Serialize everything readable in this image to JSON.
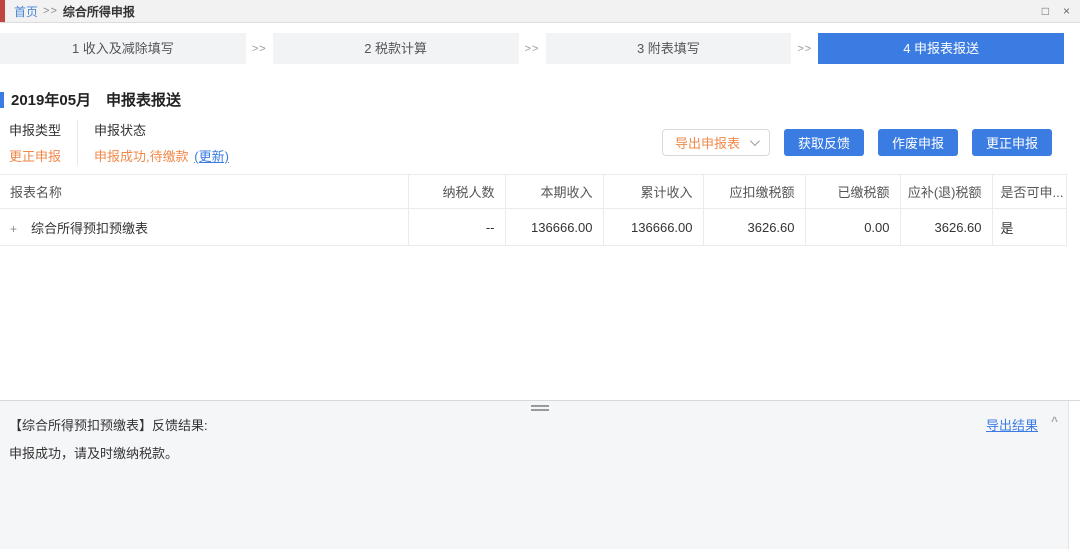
{
  "breadcrumb": {
    "home": "首页",
    "separator": ">>",
    "current": "综合所得申报"
  },
  "window_controls": {
    "maximize": "□",
    "close": "×"
  },
  "steps": {
    "separator": ">>",
    "items": [
      {
        "label": "1 收入及减除填写"
      },
      {
        "label": "2 税款计算"
      },
      {
        "label": "3 附表填写"
      },
      {
        "label": "4 申报表报送",
        "active": true
      }
    ]
  },
  "page": {
    "title": "2019年05月　申报表报送"
  },
  "meta": {
    "type_label": "申报类型",
    "type_value": "更正申报",
    "status_label": "申报状态",
    "status_value": "申报成功,待缴款",
    "status_update_link": "(更新)"
  },
  "toolbar": {
    "export_button": "导出申报表",
    "buttons": [
      "获取反馈",
      "作废申报",
      "更正申报"
    ]
  },
  "table": {
    "headers": [
      "报表名称",
      "纳税人数",
      "本期收入",
      "累计收入",
      "应扣缴税额",
      "已缴税额",
      "应补(退)税额",
      "是否可申..."
    ],
    "rows": [
      {
        "expand_icon": "+",
        "name": "综合所得预扣预缴表",
        "taxpayers": "--",
        "current_income": "136666.00",
        "accumulated_income": "136666.00",
        "withholding_tax": "3626.60",
        "paid_tax": "0.00",
        "refund_tax": "3626.60",
        "declarable": "是"
      }
    ]
  },
  "feedback": {
    "title": "【综合所得预扣预缴表】反馈结果:",
    "message": "申报成功，请及时缴纳税款。",
    "export_link": "导出结果",
    "collapse_icon": "^"
  },
  "colors": {
    "accent_blue": "#3b7ce2",
    "orange": "#f0884a",
    "green": "#4fbe87",
    "titlebar_red": "#c0443f"
  }
}
